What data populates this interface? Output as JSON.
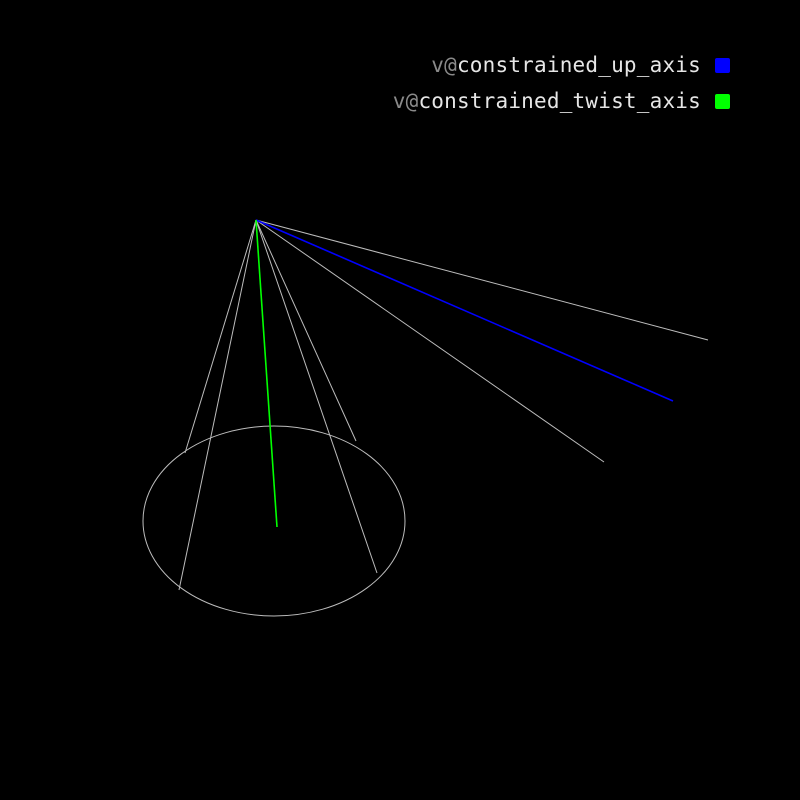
{
  "legend": {
    "items": [
      {
        "prefix": "v@",
        "label": "constrained_up_axis",
        "color": "#0000ff"
      },
      {
        "prefix": "v@",
        "label": "constrained_twist_axis",
        "color": "#00ff00"
      }
    ]
  },
  "colors": {
    "background": "#000000",
    "guide_lines": "#bdbdbd",
    "up_axis": "#0000ff",
    "twist_axis": "#00ff00"
  }
}
